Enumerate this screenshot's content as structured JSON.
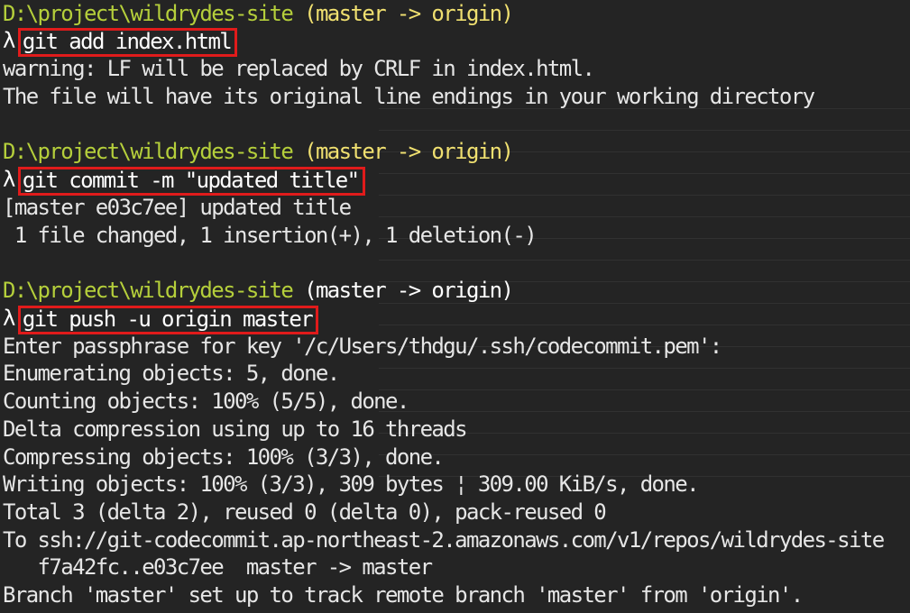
{
  "terminal": {
    "blocks": [
      {
        "path": "D:\\project\\wildrydes-site",
        "branch": "(master -> origin)",
        "prompt": "λ",
        "command": "git add index.html",
        "output": [
          "warning: LF will be replaced by CRLF in index.html.",
          "The file will have its original line endings in your working directory"
        ]
      },
      {
        "path": "D:\\project\\wildrydes-site",
        "branch": "(master -> origin)",
        "prompt": "λ",
        "command": "git commit -m \"updated title\"",
        "output": [
          "[master e03c7ee] updated title",
          " 1 file changed, 1 insertion(+), 1 deletion(-)"
        ]
      },
      {
        "path": "D:\\project\\wildrydes-site",
        "branch": "(master -> origin)",
        "prompt": "λ",
        "command": "git push -u origin master",
        "output": [
          "Enter passphrase for key '/c/Users/thdgu/.ssh/codecommit.pem':",
          "Enumerating objects: 5, done.",
          "Counting objects: 100% (5/5), done.",
          "Delta compression using up to 16 threads",
          "Compressing objects: 100% (3/3), done.",
          "Writing objects: 100% (3/3), 309 bytes ¦ 309.00 KiB/s, done.",
          "Total 3 (delta 2), reused 0 (delta 0), pack-reused 0",
          "To ssh://git-codecommit.ap-northeast-2.amazonaws.com/v1/repos/wildrydes-site",
          "   f7a42fc..e03c7ee  master -> master",
          "Branch 'master' set up to track remote branch 'master' from 'origin'."
        ]
      }
    ]
  },
  "colors": {
    "background": "#242424",
    "path": "#b5cf3b",
    "branch": "#f0e070",
    "text": "#e6e6e6",
    "highlight_box": "#e01b1b"
  }
}
